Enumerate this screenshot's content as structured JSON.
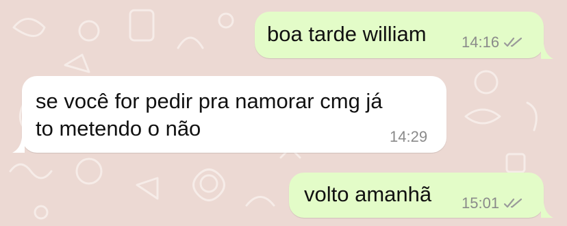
{
  "chat": {
    "messages": [
      {
        "direction": "outgoing",
        "text": "boa tarde william",
        "time": "14:16",
        "status_icon": "double-check-icon"
      },
      {
        "direction": "incoming",
        "lines": [
          "se você for pedir pra namorar cmg já",
          "to metendo o não"
        ],
        "time": "14:29"
      },
      {
        "direction": "outgoing",
        "text": "volto amanhã",
        "time": "15:01",
        "status_icon": "double-check-icon"
      }
    ]
  },
  "theme": {
    "background": "#ecd9d3",
    "outgoing_bubble": "#e3fcc8",
    "incoming_bubble": "#ffffff",
    "meta_text": "#8a8a8a"
  }
}
